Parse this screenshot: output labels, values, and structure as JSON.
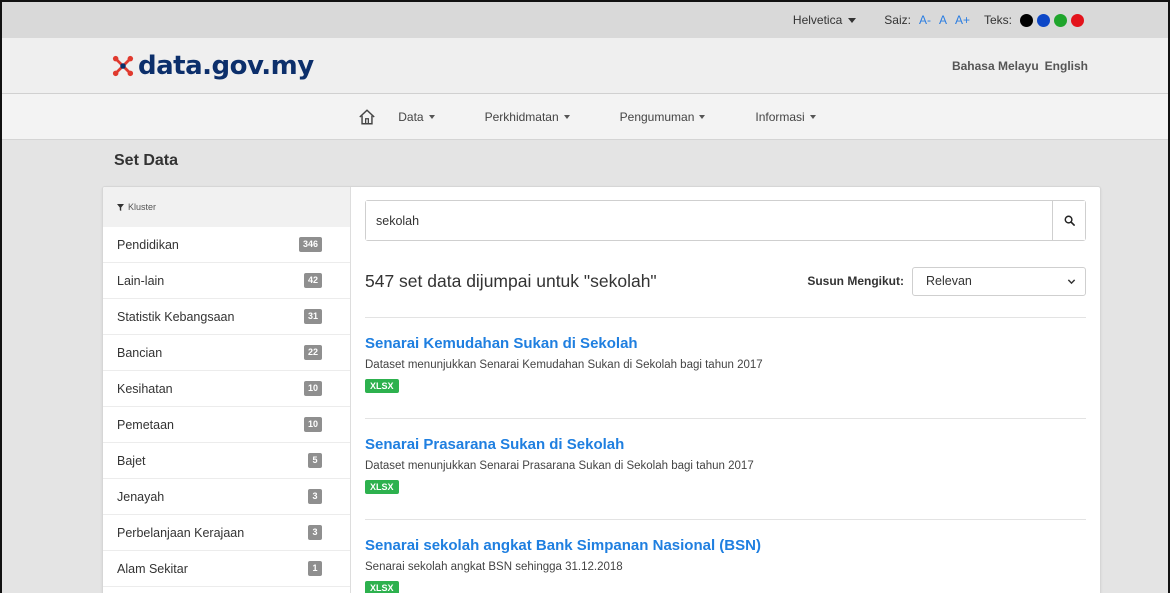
{
  "utility": {
    "font_family": "Helvetica",
    "size_label": "Saiz:",
    "size_options": [
      "A-",
      "A",
      "A+"
    ],
    "text_label": "Teks:",
    "color_swatches": [
      "#000000",
      "#0d47c7",
      "#1fa52c",
      "#e3131b"
    ]
  },
  "brand": {
    "logo_text": "data.gov.my",
    "logo_color": "#0c2f6b",
    "lang_malay": "Bahasa Melayu",
    "lang_english": "English"
  },
  "nav": {
    "items": [
      {
        "label": "Data"
      },
      {
        "label": "Perkhidmatan"
      },
      {
        "label": "Pengumuman"
      },
      {
        "label": "Informasi"
      }
    ]
  },
  "page": {
    "title": "Set Data"
  },
  "sidebar": {
    "heading": "Kluster",
    "items": [
      {
        "label": "Pendidikan",
        "count": "346"
      },
      {
        "label": "Lain-lain",
        "count": "42"
      },
      {
        "label": "Statistik Kebangsaan",
        "count": "31"
      },
      {
        "label": "Bancian",
        "count": "22"
      },
      {
        "label": "Kesihatan",
        "count": "10"
      },
      {
        "label": "Pemetaan",
        "count": "10"
      },
      {
        "label": "Bajet",
        "count": "5"
      },
      {
        "label": "Jenayah",
        "count": "3"
      },
      {
        "label": "Perbelanjaan Kerajaan",
        "count": "3"
      },
      {
        "label": "Alam Sekitar",
        "count": "1"
      }
    ]
  },
  "search": {
    "value": "sekolah",
    "result_count_text": "547 set data dijumpai untuk \"sekolah\"",
    "sort_label": "Susun Mengikut:",
    "sort_selected": "Relevan"
  },
  "datasets": [
    {
      "title": "Senarai Kemudahan Sukan di Sekolah",
      "description": "Dataset menunjukkan Senarai Kemudahan Sukan di Sekolah bagi tahun 2017",
      "format": "XLSX"
    },
    {
      "title": "Senarai Prasarana Sukan di Sekolah",
      "description": "Dataset menunjukkan Senarai Prasarana Sukan di Sekolah bagi tahun 2017",
      "format": "XLSX"
    },
    {
      "title": "Senarai sekolah angkat Bank Simpanan Nasional (BSN)",
      "description": "Senarai sekolah angkat BSN sehingga 31.12.2018",
      "format": "XLSX"
    }
  ],
  "colors": {
    "link_blue": "#1f7fe0",
    "format_green": "#2db14e",
    "badge_gray": "#8f8f8f"
  }
}
